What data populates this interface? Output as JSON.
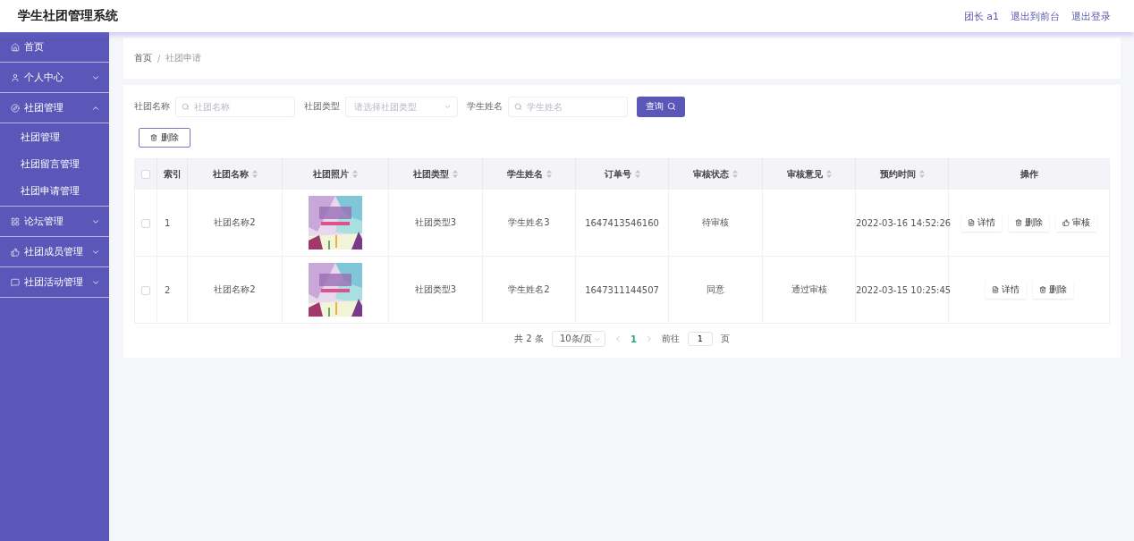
{
  "header": {
    "title": "学生社团管理系统",
    "links": [
      "团长 a1",
      "退出到前台",
      "退出登录"
    ]
  },
  "sidebar": {
    "items": [
      {
        "label": "首页",
        "kind": "home"
      },
      {
        "label": "个人中心",
        "kind": "user",
        "expanded": false
      },
      {
        "label": "社团管理",
        "kind": "compass",
        "expanded": true,
        "children": [
          {
            "label": "社团管理"
          },
          {
            "label": "社团留言管理"
          },
          {
            "label": "社团申请管理"
          }
        ]
      },
      {
        "label": "论坛管理",
        "kind": "grid",
        "expanded": false
      },
      {
        "label": "社团成员管理",
        "kind": "thumb",
        "expanded": false
      },
      {
        "label": "社团活动管理",
        "kind": "message",
        "expanded": false
      }
    ]
  },
  "breadcrumb": {
    "items": [
      "首页",
      "社团申请"
    ],
    "separator": "/"
  },
  "filters": [
    {
      "label": "社团名称",
      "kind": "search",
      "placeholder": "社团名称"
    },
    {
      "label": "社团类型",
      "kind": "select",
      "placeholder": "请选择社团类型"
    },
    {
      "label": "学生姓名",
      "kind": "search",
      "placeholder": "学生姓名"
    }
  ],
  "query_button": "查询",
  "delete_button": "删除",
  "table": {
    "select_all_checked": false,
    "columns": [
      {
        "label": "索引",
        "sortable": false
      },
      {
        "label": "社团名称",
        "sortable": true
      },
      {
        "label": "社团照片",
        "sortable": true
      },
      {
        "label": "社团类型",
        "sortable": true
      },
      {
        "label": "学生姓名",
        "sortable": true
      },
      {
        "label": "订单号",
        "sortable": true
      },
      {
        "label": "审核状态",
        "sortable": true
      },
      {
        "label": "审核意见",
        "sortable": true
      },
      {
        "label": "预约时间",
        "sortable": true
      },
      {
        "label": "操作",
        "sortable": false
      }
    ],
    "rows": [
      {
        "checked": false,
        "index": "1",
        "name": "社团名称2",
        "photo": {
          "kind": "picture"
        },
        "type": "社团类型3",
        "student": "学生姓名3",
        "order_no": "1647413546160",
        "status": "待审核",
        "opinion": "",
        "time": "2022-03-16 14:52:26",
        "actions": [
          {
            "kind": "detail",
            "label": "详情"
          },
          {
            "kind": "delete",
            "label": "删除"
          },
          {
            "kind": "review",
            "label": "审核"
          }
        ]
      },
      {
        "checked": false,
        "index": "2",
        "name": "社团名称2",
        "photo": {
          "kind": "picture"
        },
        "type": "社团类型3",
        "student": "学生姓名2",
        "order_no": "1647311144507",
        "status": "同意",
        "opinion": "通过审核",
        "time": "2022-03-15 10:25:45",
        "actions": [
          {
            "kind": "detail",
            "label": "详情"
          },
          {
            "kind": "delete",
            "label": "删除"
          }
        ]
      }
    ]
  },
  "pagination": {
    "total": "共 2 条",
    "page_size": "10条/页",
    "pages": [
      {
        "label": "1",
        "selected": true
      }
    ],
    "goto_label": "前往",
    "goto_value": "1",
    "page_suffix": "页"
  }
}
